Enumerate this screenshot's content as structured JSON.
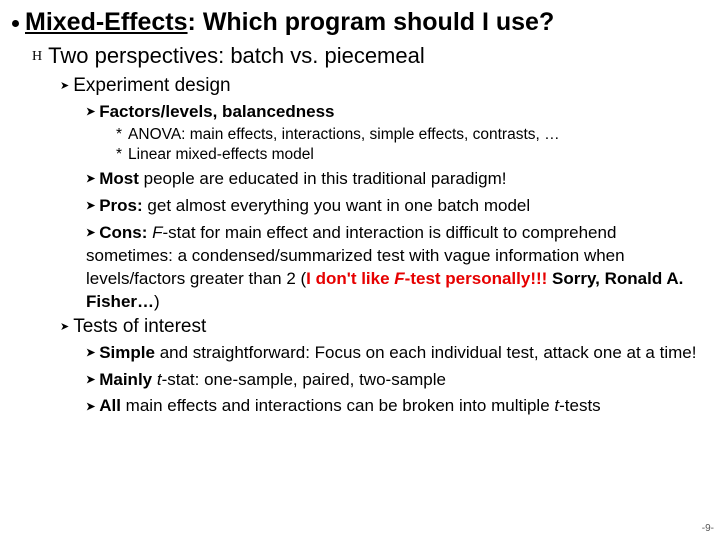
{
  "title": {
    "lead": "Mixed-Effects",
    "rest": ": Which program should I use?"
  },
  "perspectives": {
    "prefix": "H",
    "text": "Two perspectives: batch vs. piecemeal"
  },
  "expDesign": {
    "label": "Experiment design"
  },
  "factors": {
    "label": "Factors/levels, balancedness",
    "items": [
      "ANOVA: main effects, interactions, simple effects, contrasts, …",
      "Linear mixed-effects model"
    ]
  },
  "most": {
    "lead": "Most",
    "rest": " people are educated in this traditional paradigm!"
  },
  "pros": {
    "lead": "Pros:",
    "rest": " get almost everything you want in one batch model"
  },
  "cons": {
    "lead": "Cons:",
    "seg1": "F",
    "seg2": "-stat for main effect and interaction is difficult to comprehend sometimes: a condensed/summarized test with vague information when levels/factors greater than 2 (",
    "seg3a": "I don't like ",
    "seg3b": "F",
    "seg3c": "-test personally!!!",
    "seg4": " Sorry, Ronald A. Fisher…",
    "seg5": ")"
  },
  "tests": {
    "label": "Tests of interest"
  },
  "simple": {
    "lead": "Simple",
    "rest": " and straightforward: Focus on each individual test, attack one at a time!"
  },
  "mainly": {
    "lead": "Mainly",
    "seg1": "t",
    "seg2": "-stat: one-sample, paired, two-sample"
  },
  "all": {
    "lead": "All",
    "rest": " main effects and interactions can be broken into multiple ",
    "tail1": "t",
    "tail2": "-tests"
  },
  "page": "-9-",
  "glyph": {
    "chev": "➤"
  }
}
